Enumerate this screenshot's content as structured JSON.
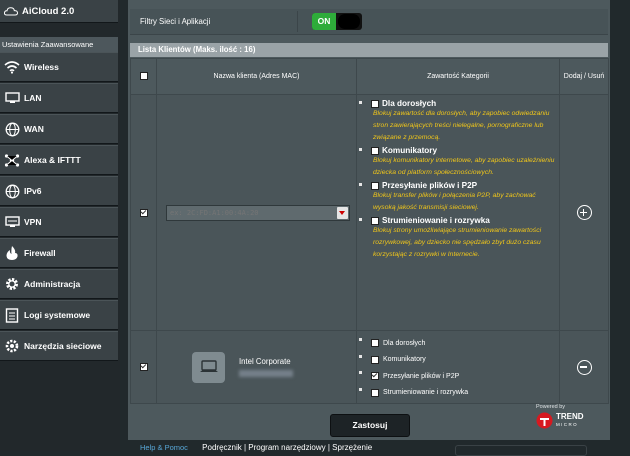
{
  "sidebar": {
    "aicloud": "AiCloud 2.0",
    "section_header": "Ustawienia Zaawansowane",
    "items": [
      {
        "label": "Wireless",
        "icon": "wifi-icon"
      },
      {
        "label": "LAN",
        "icon": "lan-icon"
      },
      {
        "label": "WAN",
        "icon": "globe-icon"
      },
      {
        "label": "Alexa & IFTTT",
        "icon": "network-nodes-icon"
      },
      {
        "label": "IPv6",
        "icon": "globe-icon"
      },
      {
        "label": "VPN",
        "icon": "vpn-icon"
      },
      {
        "label": "Firewall",
        "icon": "flame-icon"
      },
      {
        "label": "Administracja",
        "icon": "gear-icon"
      },
      {
        "label": "Logi systemowe",
        "icon": "log-icon"
      },
      {
        "label": "Narzędzia sieciowe",
        "icon": "tools-icon"
      }
    ]
  },
  "main": {
    "filter_label": "Filtry Sieci i Aplikacji",
    "toggle_label": "ON",
    "list_title": "Lista Klientów (Maks. ilość : 16)",
    "columns": {
      "name": "Nazwa klienta (Adres MAC)",
      "content": "Zawartość Kategorii",
      "action": "Dodaj / Usuń"
    },
    "add_row": {
      "mac_placeholder": "ex: 2C:FD:A1:00:4A:20",
      "categories": [
        {
          "title": "Dla dorosłych",
          "desc": "Blokuj zawartość dla dorosłych, aby zapobiec odwiedzaniu stron zawierających treści nielegalne, pornograficzne lub związane z przemocą."
        },
        {
          "title": "Komunikatory",
          "desc": "Blokuj komunikatory internetowe, aby zapobiec uzależnieniu dziecka od platform społecznościowych."
        },
        {
          "title": "Przesyłanie plików i P2P",
          "desc": "Blokuj transfer plików i połączenia P2P, aby zachować wysoką jakość transmisji sieciowej."
        },
        {
          "title": "Strumieniowanie i rozrywka",
          "desc": "Blokuj strony umożliwiające strumieniowanie zawartości rozrywkowej, aby dziecko nie spędzało zbyt dużo czasu korzystając z rozrywki w Internecie."
        }
      ]
    },
    "client": {
      "name": "Intel Corporate",
      "categories": [
        {
          "label": "Dla dorosłych",
          "checked": false
        },
        {
          "label": "Komunikatory",
          "checked": false
        },
        {
          "label": "Przesyłanie plików i P2P",
          "checked": true
        },
        {
          "label": "Strumieniowanie i rozrywka",
          "checked": false
        }
      ]
    },
    "apply": "Zastosuj",
    "powered_by": "Powered by",
    "trend_line1": "TREND",
    "trend_line2": "MICRO"
  },
  "footer": {
    "help": "Help & Pomoc",
    "links": "Podręcznik | Program narzędziowy | Sprzężenie"
  },
  "colors": {
    "accent_on": "#2eac3a",
    "warning_text": "#f0c61a",
    "trend_red": "#d71920"
  }
}
